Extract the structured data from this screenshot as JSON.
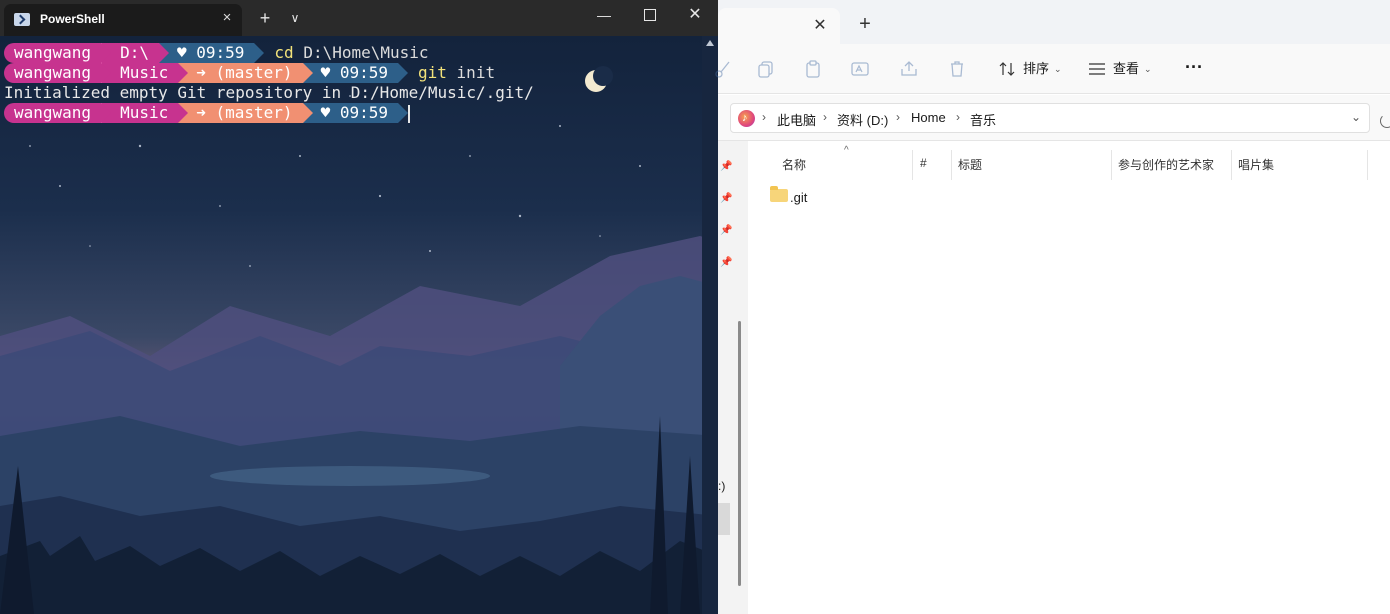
{
  "terminal": {
    "tab_title": "PowerShell",
    "tab_close_icon": "×",
    "new_tab_icon": "+",
    "tab_menu_icon": "∨",
    "min_icon": "—",
    "close_icon": "✕",
    "lines": [
      {
        "user": "wangwang",
        "path": "D:\\",
        "git": "",
        "time": "♥ 09:59",
        "cmd": "cd",
        "arg": "D:\\Home\\Music"
      },
      {
        "user": "wangwang",
        "path": "Music",
        "git": "➜ (master)",
        "time": "♥ 09:59",
        "cmd": "git",
        "arg": "init"
      },
      {
        "user": "wangwang",
        "path": "Music",
        "git": "➜ (master)",
        "time": "♥ 09:59",
        "cmd": "",
        "arg": ""
      }
    ],
    "output": "Initialized empty Git repository in D:/Home/Music/.git/"
  },
  "explorer": {
    "tab_close_icon": "✕",
    "new_tab_icon": "+",
    "toolbar": {
      "sort_label": "排序",
      "view_label": "查看",
      "caret": "⌄",
      "more_label": "···"
    },
    "breadcrumb": [
      "此电脑",
      "资料 (D:)",
      "Home",
      "音乐"
    ],
    "breadcrumb_sep": "›",
    "dropdown_icon": "⌄",
    "columns": [
      "名称",
      "#",
      "标题",
      "参与创作的艺术家",
      "唱片集"
    ],
    "sort_arrow": "^",
    "files": [
      ".git"
    ],
    "nav_truncated": ":)"
  },
  "colors": {
    "prompt_user": "#c7338f",
    "prompt_git": "#f19072",
    "prompt_time": "#2d5f89",
    "cmd": "#f2e27a"
  }
}
